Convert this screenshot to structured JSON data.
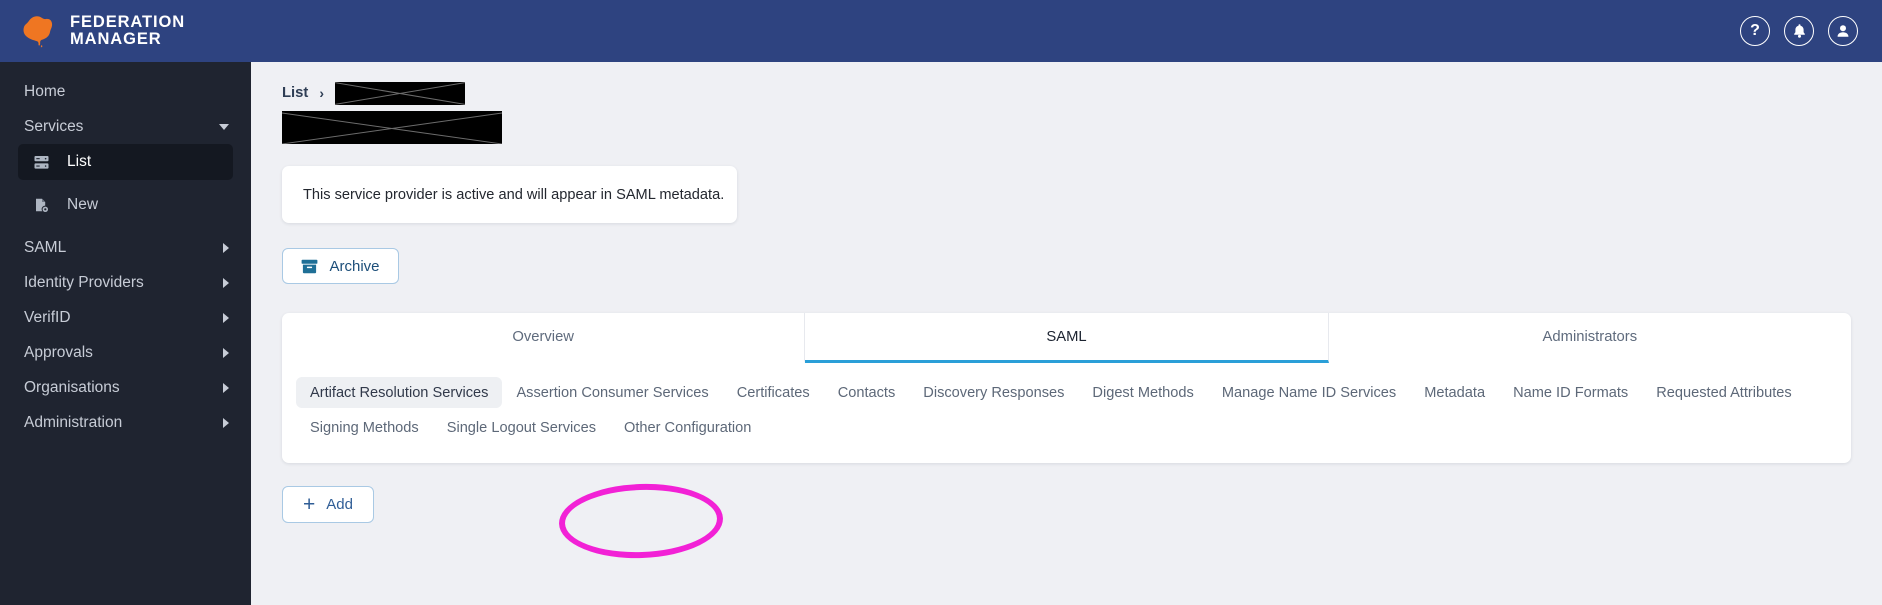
{
  "header": {
    "brand_line1": "FEDERATION",
    "brand_line2": "MANAGER",
    "logo_icon": "australia-map-logo",
    "actions": [
      {
        "name": "help-icon",
        "glyph": "?"
      },
      {
        "name": "notifications-bell-icon",
        "glyph": "bell"
      },
      {
        "name": "user-account-icon",
        "glyph": "user"
      }
    ]
  },
  "sidebar": {
    "items": [
      {
        "label": "Home",
        "caret": "none"
      },
      {
        "label": "Services",
        "caret": "down"
      },
      {
        "label": "SAML",
        "caret": "right"
      },
      {
        "label": "Identity Providers",
        "caret": "right"
      },
      {
        "label": "VerifID",
        "caret": "right"
      },
      {
        "label": "Approvals",
        "caret": "right"
      },
      {
        "label": "Organisations",
        "caret": "right"
      },
      {
        "label": "Administration",
        "caret": "right"
      }
    ],
    "services_children": [
      {
        "label": "List",
        "icon": "server-list-icon",
        "active": true
      },
      {
        "label": "New",
        "icon": "new-document-gear-icon",
        "active": false
      }
    ]
  },
  "breadcrumb": {
    "root": "List",
    "separator": "›",
    "redacted_current": ""
  },
  "page": {
    "redacted_title": "",
    "alert_message": "This service provider is active and will appear in SAML metadata."
  },
  "toolbar": {
    "archive_label": "Archive",
    "archive_icon": "archive-box-icon",
    "add_label": "Add",
    "add_icon": "plus-icon"
  },
  "tabs": [
    {
      "label": "Overview",
      "active": false
    },
    {
      "label": "SAML",
      "active": true
    },
    {
      "label": "Administrators",
      "active": false
    }
  ],
  "subtabs": [
    {
      "label": "Artifact Resolution Services",
      "active": true
    },
    {
      "label": "Assertion Consumer Services",
      "active": false
    },
    {
      "label": "Certificates",
      "active": false
    },
    {
      "label": "Contacts",
      "active": false
    },
    {
      "label": "Discovery Responses",
      "active": false
    },
    {
      "label": "Digest Methods",
      "active": false
    },
    {
      "label": "Manage Name ID Services",
      "active": false
    },
    {
      "label": "Metadata",
      "active": false
    },
    {
      "label": "Name ID Formats",
      "active": false
    },
    {
      "label": "Requested Attributes",
      "active": false
    },
    {
      "label": "Signing Methods",
      "active": false
    },
    {
      "label": "Single Logout Services",
      "active": false
    },
    {
      "label": "Other Configuration",
      "active": false
    }
  ],
  "annotation": {
    "kind": "ellipse-highlight",
    "color": "#f221d6",
    "targets": "Requested Attributes"
  },
  "colors": {
    "header_bg": "#2e4380",
    "sidebar_bg": "#1f2430",
    "content_bg": "#eff0f4",
    "accent_tab": "#2a9fd8",
    "logo_orange": "#ef7622",
    "annotation": "#f221d6"
  }
}
